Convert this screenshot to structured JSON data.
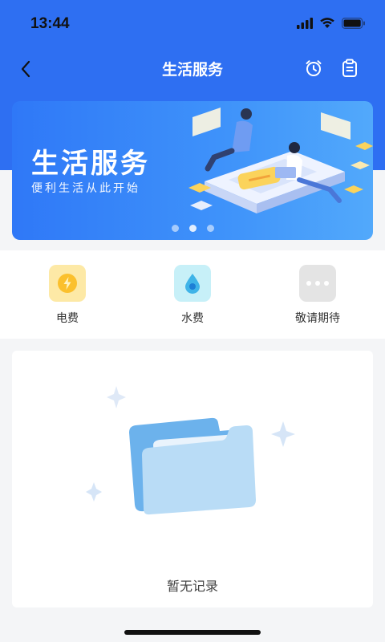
{
  "status_bar": {
    "time": "13:44"
  },
  "nav": {
    "title": "生活服务"
  },
  "banner": {
    "title": "生活服务",
    "subtitle": "便利生活从此开始",
    "slide_count": 3,
    "active_slide": 2
  },
  "services": [
    {
      "label": "电费",
      "icon": "lightning-icon",
      "bg": "#fde9a6"
    },
    {
      "label": "水费",
      "icon": "water-drop-icon",
      "bg": "#c7f0f8"
    },
    {
      "label": "敬请期待",
      "icon": "more-dots-icon",
      "bg": "#e4e4e4"
    }
  ],
  "records": {
    "empty_text": "暂无记录"
  },
  "colors": {
    "primary": "#2e6ff2",
    "page_bg": "#f4f5f7"
  }
}
